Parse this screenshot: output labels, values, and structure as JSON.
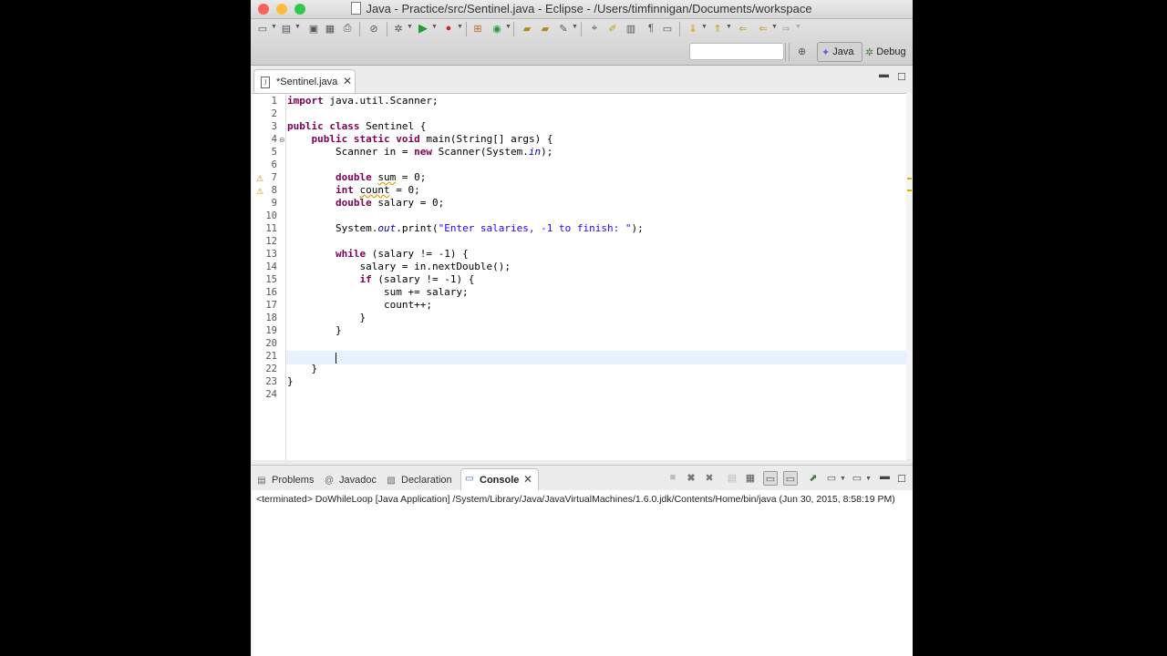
{
  "window": {
    "title": "Java - Practice/src/Sentinel.java - Eclipse - /Users/timfinnigan/Documents/workspace",
    "traffic_lights": {
      "close": "#fc605b",
      "minimize": "#fdbc40",
      "zoom": "#34c84a"
    }
  },
  "toolbar": {
    "icons": [
      "new-icon",
      "new-type-icon",
      "save-icon",
      "save-all-icon",
      "print-icon",
      "skip-breakpoints-icon",
      "debug-icon",
      "run-icon",
      "run-external-tools-icon",
      "coverage-icon",
      "new-java-package-icon",
      "new-java-class-icon",
      "open-type-icon",
      "search-icon",
      "toggle-mark-occurrences-icon",
      "block-selection-icon",
      "show-whitespace-icon",
      "next-annotation-icon",
      "previous-annotation-icon",
      "back-icon",
      "forward-icon"
    ]
  },
  "quick_access": {
    "placeholder": ""
  },
  "perspectives": {
    "java_label": "Java",
    "debug_label": "Debug"
  },
  "editor": {
    "tab_label": "*Sentinel.java",
    "line_numbers": [
      "1",
      "2",
      "3",
      "4",
      "5",
      "6",
      "7",
      "8",
      "9",
      "10",
      "11",
      "12",
      "13",
      "14",
      "15",
      "16",
      "17",
      "18",
      "19",
      "20",
      "21",
      "22",
      "23",
      "24"
    ],
    "lines": [
      "import java.util.Scanner;",
      "",
      "public class Sentinel {",
      "    public static void main(String[] args) {",
      "        Scanner in = new Scanner(System.in);",
      "",
      "        double sum = 0;",
      "        int count = 0;",
      "        double salary = 0;",
      "",
      "        System.out.print(\"Enter salaries, -1 to finish: \");",
      "",
      "        while (salary != -1) {",
      "            salary = in.nextDouble();",
      "            if (salary != -1) {",
      "                sum += salary;",
      "                count++;",
      "            }",
      "        }",
      "",
      "",
      "    }",
      "}",
      ""
    ],
    "current_line": 21,
    "warning_lines": [
      7,
      8
    ],
    "colors": {
      "keyword": "#7f0055",
      "string": "#2a00ff",
      "field": "#0000c0",
      "current_line_bg": "#e8f2fe"
    }
  },
  "bottom_panel": {
    "tabs": [
      {
        "label": "Problems",
        "icon": "problems-icon"
      },
      {
        "label": "Javadoc",
        "icon": "javadoc-icon"
      },
      {
        "label": "Declaration",
        "icon": "declaration-icon"
      },
      {
        "label": "Console",
        "icon": "console-icon",
        "active": true
      }
    ],
    "console_status": "<terminated> DoWhileLoop [Java Application] /System/Library/Java/JavaVirtualMachines/1.6.0.jdk/Contents/Home/bin/java (Jun 30, 2015, 8:58:19 PM)"
  }
}
